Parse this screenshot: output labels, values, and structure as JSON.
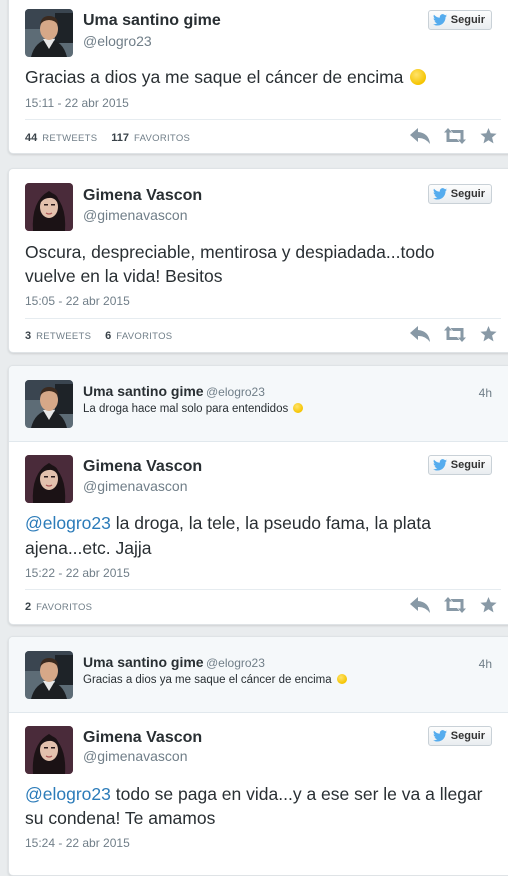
{
  "follow_label": "Seguir",
  "reply_time": "4h",
  "users": {
    "uma": {
      "name": "Uma santino gime",
      "handle": "@elogro23"
    },
    "gimena": {
      "name": "Gimena Vascon",
      "handle": "@gimenavascon"
    }
  },
  "tweets": [
    {
      "text": "Gracias a dios ya me saque el cáncer de encima",
      "time": "15:11 - 22 abr 2015",
      "retweets": "44",
      "retweets_label": "RETWEETS",
      "favorites": "117",
      "favorites_label": "FAVORITOS"
    },
    {
      "text_line1": "Oscura, despreciable, mentirosa y despiadada...todo",
      "text_line2": "vuelve en la vida! Besitos",
      "time": "15:05 - 22 abr 2015",
      "retweets": "3",
      "retweets_label": "RETWEETS",
      "favorites": "6",
      "favorites_label": "FAVORITOS"
    },
    {
      "in_reply_text": "La droga hace mal solo para entendidos",
      "mention": "@elogro23",
      "text_line1_rest": " la droga, la tele,  la pseudo fama, la plata",
      "text_line2": "ajena...etc. Jajja",
      "time": "15:22 - 22 abr 2015",
      "favorites": "2",
      "favorites_label": "FAVORITOS"
    },
    {
      "in_reply_text": "Gracias a dios ya me saque el cáncer de encima",
      "mention": "@elogro23",
      "text_line1_rest": " todo se paga en vida...y a ese ser le va a llegar",
      "text_line2": "su condena! Te amamos",
      "time": "15:24 - 22 abr 2015"
    }
  ],
  "icons": [
    "twitter-bird-icon",
    "reply-icon",
    "retweet-icon",
    "favorite-star-icon",
    "smiley-emoji-icon"
  ],
  "colors": {
    "link": "#2b7bb9",
    "muted": "#707e88",
    "bird": "#55acee",
    "action": "#8899a6"
  }
}
